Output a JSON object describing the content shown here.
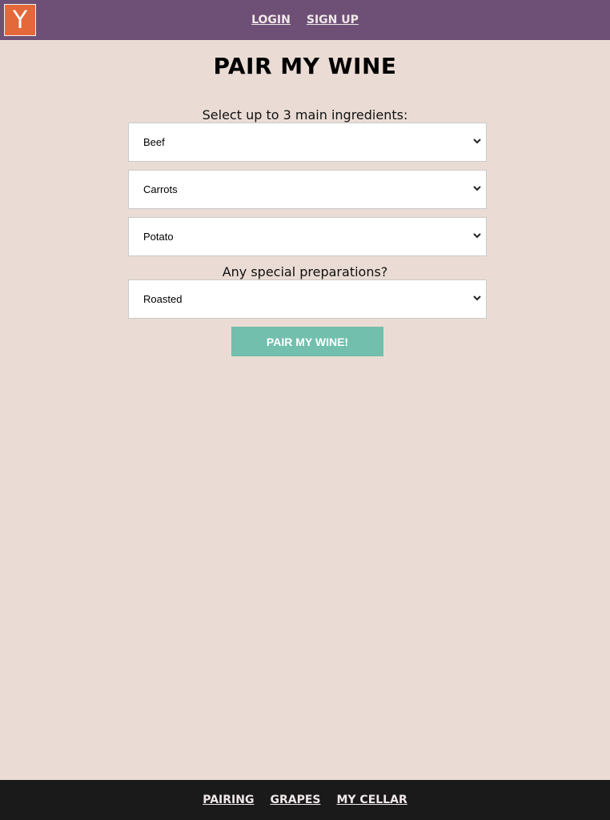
{
  "header": {
    "logo_text": "Y",
    "login_label": "LOGIN",
    "signup_label": "SIGN UP"
  },
  "main": {
    "title": "PAIR MY WINE",
    "ingredients_label": "Select up to 3 main ingredients:",
    "ingredients": [
      "Beef",
      "Carrots",
      "Potato"
    ],
    "preparation_label": "Any special preparations?",
    "preparation": "Roasted",
    "submit_label": "PAIR MY WINE!"
  },
  "footer": {
    "nav": [
      "PAIRING",
      "GRAPES",
      "MY CELLAR"
    ]
  },
  "colors": {
    "header_bg": "#6e5076",
    "logo_bg": "#e4683a",
    "page_bg": "#eadcd4",
    "button_bg": "#72bfad",
    "footer_bg": "#1a1a1a"
  },
  "icons": {
    "select_arrow": "chevron-down-icon"
  }
}
